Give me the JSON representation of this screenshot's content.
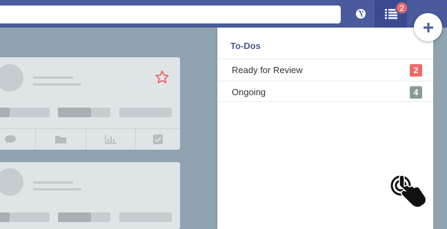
{
  "topbar": {
    "search": {
      "value": "",
      "placeholder": ""
    },
    "globe_icon": "globe-icon",
    "todo_icon": "list-icon",
    "todo_count": "2",
    "add_icon": "plus-icon"
  },
  "todos_panel": {
    "title": "To-Dos",
    "items": [
      {
        "label": "Ready for Review",
        "count": "2",
        "badge_color": "#f06a6a"
      },
      {
        "label": "Ongoing",
        "count": "4",
        "badge_color": "#8a9a98"
      }
    ]
  },
  "cards": {
    "star_icon": "star-icon",
    "action_icons": [
      "comment-icon",
      "folder-icon",
      "chart-icon",
      "checkbox-icon"
    ]
  },
  "colors": {
    "brand": "#4a5a9c",
    "brand_dark": "#3b4a8f",
    "background": "#8fa4b0",
    "alert": "#f06a6a"
  }
}
